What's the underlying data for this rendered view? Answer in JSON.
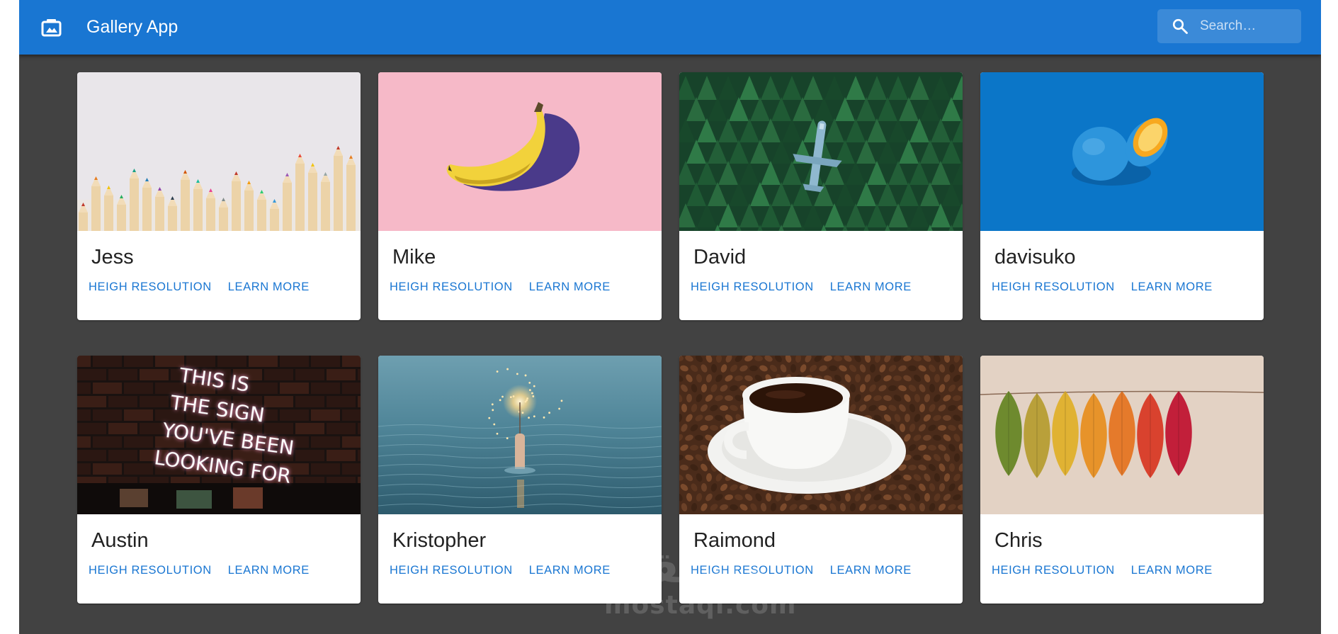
{
  "app": {
    "title": "Gallery App",
    "icon": "photo-album-icon",
    "colors": {
      "appbar": "#1976d2",
      "background": "#424242",
      "card": "#ffffff",
      "action": "#1976d2"
    }
  },
  "search": {
    "placeholder": "Search…",
    "value": "",
    "icon": "search-icon"
  },
  "cards": [
    {
      "name": "Jess",
      "image": "colored-pencils-photo",
      "actions": [
        "HEIGH RESOLUTION",
        "LEARN MORE"
      ]
    },
    {
      "name": "Mike",
      "image": "banana-on-pink-photo",
      "actions": [
        "HEIGH RESOLUTION",
        "LEARN MORE"
      ]
    },
    {
      "name": "David",
      "image": "airplane-in-forest-photo",
      "actions": [
        "HEIGH RESOLUTION",
        "LEARN MORE"
      ]
    },
    {
      "name": "davisuko",
      "image": "blue-orange-photo",
      "actions": [
        "HEIGH RESOLUTION",
        "LEARN MORE"
      ]
    },
    {
      "name": "Austin",
      "image": "neon-sign-photo",
      "actions": [
        "HEIGH RESOLUTION",
        "LEARN MORE"
      ]
    },
    {
      "name": "Kristopher",
      "image": "sparkler-in-water-photo",
      "actions": [
        "HEIGH RESOLUTION",
        "LEARN MORE"
      ]
    },
    {
      "name": "Raimond",
      "image": "coffee-cup-on-beans-photo",
      "actions": [
        "HEIGH RESOLUTION",
        "LEARN MORE"
      ]
    },
    {
      "name": "Chris",
      "image": "autumn-leaves-photo",
      "actions": [
        "HEIGH RESOLUTION",
        "LEARN MORE"
      ]
    }
  ],
  "neon_sign": {
    "lines": [
      "THIS IS",
      "THE SIGN",
      "YOU'VE BEEN",
      "LOOKING FOR"
    ]
  },
  "watermark": {
    "arabic": "مستقل",
    "latin": "mostaqi.com"
  }
}
